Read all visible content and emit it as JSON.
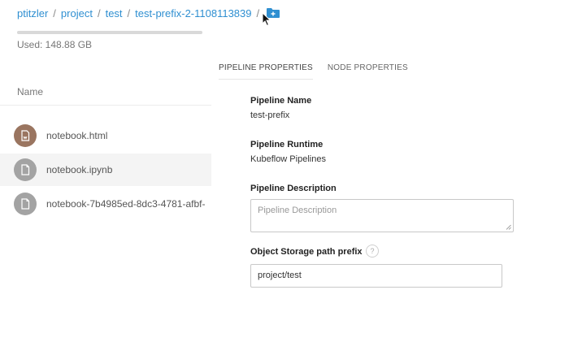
{
  "breadcrumb": {
    "items": [
      "ptitzler",
      "project",
      "test",
      "test-prefix-2-1108113839"
    ],
    "separator": "/",
    "folder_icon": "new-folder-icon"
  },
  "storage": {
    "used_label": "Used: 148.88 GB"
  },
  "file_list": {
    "header": "Name",
    "files": [
      {
        "name": "notebook.html",
        "icon": "html-file-icon",
        "icon_color": "#9a7560",
        "selected": false
      },
      {
        "name": "notebook.ipynb",
        "icon": "file-icon",
        "icon_color": "#a3a3a3",
        "selected": true
      },
      {
        "name": "notebook-7b4985ed-8dc3-4781-afbf-",
        "icon": "file-icon",
        "icon_color": "#a3a3a3",
        "selected": false
      }
    ]
  },
  "tabs": [
    {
      "label": "PIPELINE PROPERTIES",
      "active": true
    },
    {
      "label": "NODE PROPERTIES",
      "active": false
    }
  ],
  "properties": {
    "pipeline_name_label": "Pipeline Name",
    "pipeline_name_value": "test-prefix",
    "runtime_label": "Pipeline Runtime",
    "runtime_value": "Kubeflow Pipelines",
    "description_label": "Pipeline Description",
    "description_placeholder": "Pipeline Description",
    "storage_prefix_label": "Object Storage path prefix",
    "storage_prefix_help": "?",
    "storage_prefix_value": "project/test"
  },
  "colors": {
    "link": "#2f8fd1",
    "folder_icon": "#2f8fd1"
  }
}
